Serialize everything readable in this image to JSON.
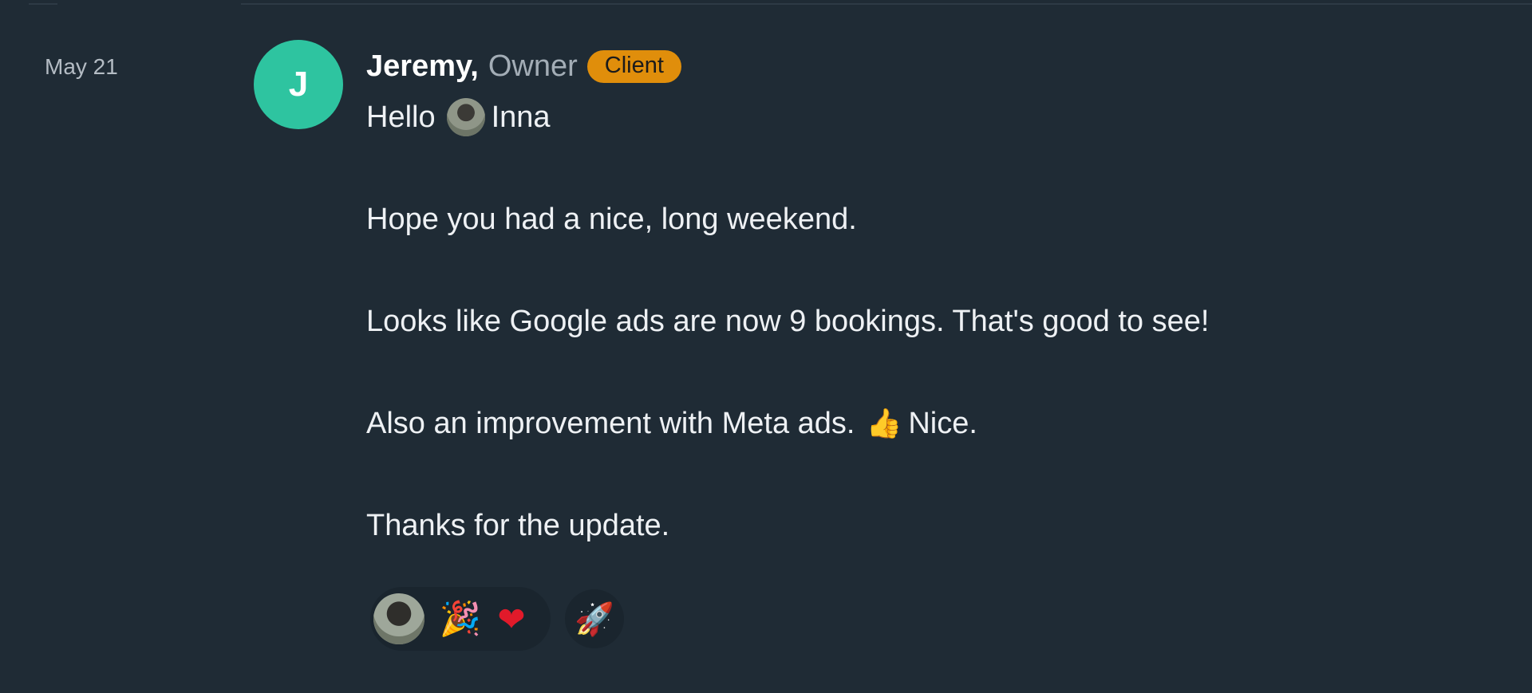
{
  "message": {
    "date": "May 21",
    "avatar_initial": "J",
    "author_name": "Jeremy,",
    "author_role": "Owner",
    "badge": "Client",
    "greeting": "Hello",
    "mention": "Inna",
    "line_1": "Hope you had a nice, long weekend.",
    "line_2": "Looks like Google ads are now 9 bookings. That's good to see!",
    "line_3_start": "Also an improvement with Meta ads.",
    "line_3_emoji": "👍",
    "line_3_end": "Nice.",
    "line_4": "Thanks for the update."
  },
  "reactions": {
    "emojis": [
      "🎉",
      "❤"
    ],
    "add_reaction_emoji": "🚀"
  },
  "colors": {
    "background": "#1f2b35",
    "avatar": "#2ec4a0",
    "badge": "#e08e0b",
    "muted_text": "#a3adb6"
  },
  "icons": {
    "mention_avatar": "user-photo-avatar",
    "thumbs": "thumbs-up-emoji",
    "party": "party-popper-emoji",
    "heart": "red-heart-emoji",
    "rocket": "rocket-emoji"
  }
}
